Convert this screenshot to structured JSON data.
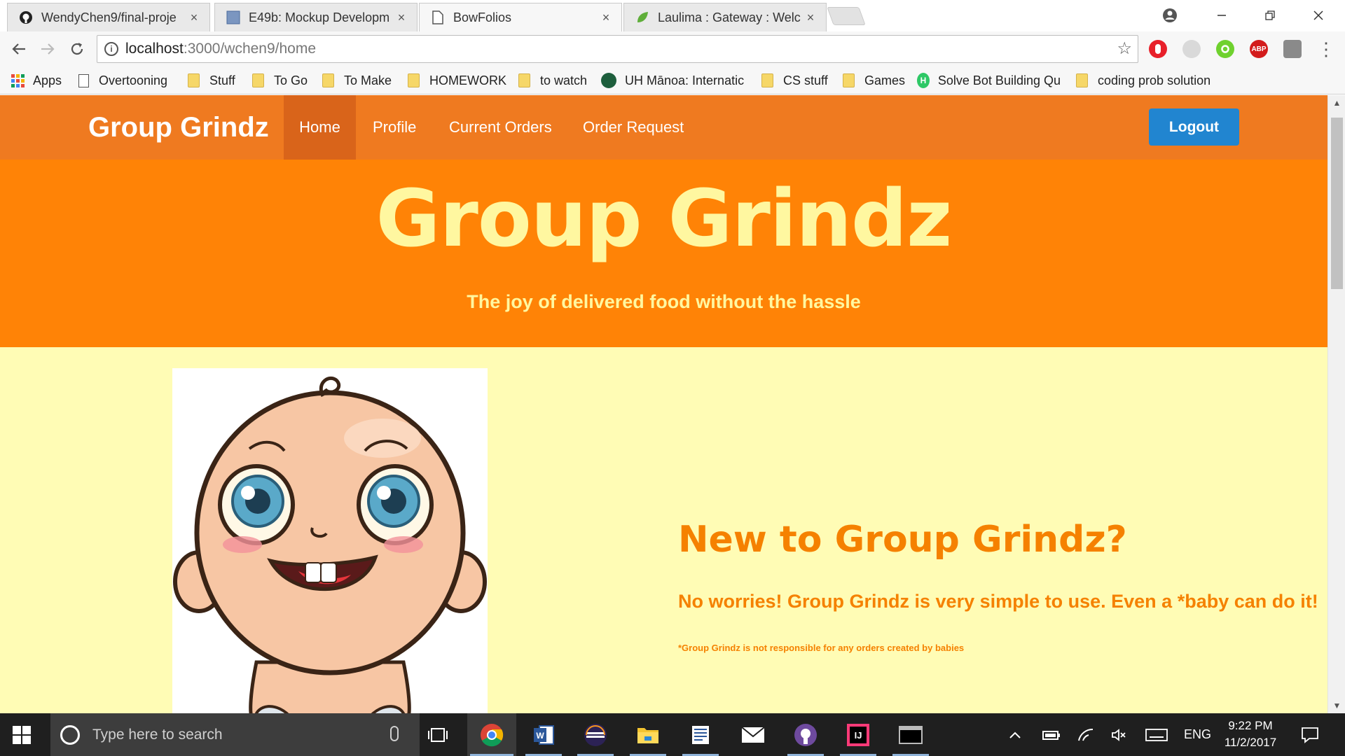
{
  "browser": {
    "tabs": [
      {
        "title": "WendyChen9/final-proje",
        "icon": "github-icon",
        "active": false
      },
      {
        "title": "E49b: Mockup Developm",
        "icon": "doc-icon",
        "active": false
      },
      {
        "title": "BowFolios",
        "icon": "page-icon",
        "active": true
      },
      {
        "title": "Laulima : Gateway : Welc",
        "icon": "leaf-icon",
        "active": false
      }
    ],
    "tab_close": "×",
    "url_host": "localhost",
    "url_path": ":3000/wchen9/home",
    "bookmarks": [
      {
        "label": "Apps",
        "type": "apps"
      },
      {
        "label": "Overtooning",
        "type": "page"
      },
      {
        "label": "Stuff",
        "type": "folder"
      },
      {
        "label": "To Go",
        "type": "folder"
      },
      {
        "label": "To Make",
        "type": "folder"
      },
      {
        "label": "HOMEWORK",
        "type": "folder"
      },
      {
        "label": "to watch",
        "type": "folder"
      },
      {
        "label": "UH Mānoa: Internatic",
        "type": "uh"
      },
      {
        "label": "CS stuff",
        "type": "folder"
      },
      {
        "label": "Games",
        "type": "folder"
      },
      {
        "label": "Solve Bot Building Qu",
        "type": "hackerrank"
      },
      {
        "label": "coding prob solution",
        "type": "folder"
      }
    ]
  },
  "site": {
    "brand": "Group Grindz",
    "nav": [
      {
        "label": "Home",
        "active": true
      },
      {
        "label": "Profile",
        "active": false
      },
      {
        "label": "Current Orders",
        "active": false
      },
      {
        "label": "Order Request",
        "active": false
      }
    ],
    "logout_label": "Logout",
    "hero": {
      "title": "Group Grindz",
      "subtitle": "The joy of delivered food without the hassle"
    },
    "promo": {
      "title": "New to Group Grindz?",
      "text": "No worries! Group Grindz is very simple to use. Even a *baby can do it!",
      "note": "*Group Grindz is not responsible for any orders created by babies"
    },
    "colors": {
      "navbar": "#ef7a20",
      "hero": "#ff8306",
      "hero_text": "#fff7a0",
      "content_bg": "#fffcb5",
      "accent": "#f58100",
      "logout": "#2185d0"
    }
  },
  "taskbar": {
    "search_placeholder": "Type here to search",
    "language": "ENG",
    "time": "9:22 PM",
    "date": "11/2/2017"
  }
}
